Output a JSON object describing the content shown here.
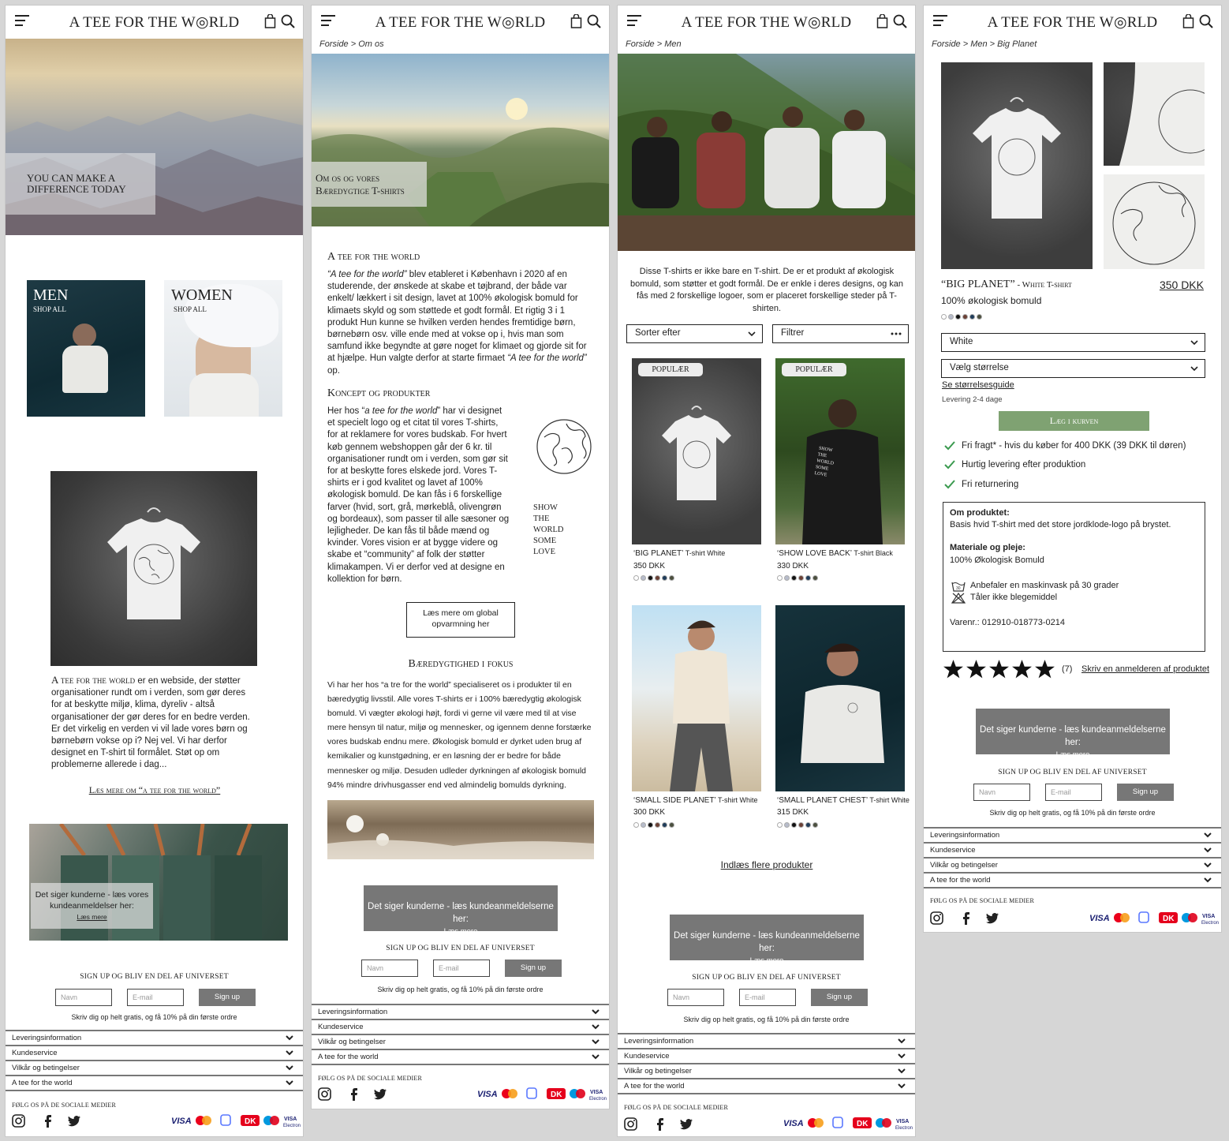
{
  "brand": "A TEE FOR THE W◎RLD",
  "home": {
    "hero_text_line1": "YOU CAN MAKE A",
    "hero_text_line2": "DIFFERENCE TODAY",
    "men_title": "MEN",
    "men_sub": "SHOP ALL",
    "women_title": "WOMEN",
    "women_sub": "SHOP ALL",
    "about_brand": "A tee for the world",
    "about_text": " er en webside, der støtter organisationer rundt om i verden, som gør deres for at beskytte miljø, klima, dyreliv - altså organisationer der gør deres for en bedre verden. Er det virkelig en verden vi vil lade vores børn og børnebørn vokse op i? Nej vel. Vi har derfor designet en T-shirt til formålet. Støt op om problemerne allerede i dag...",
    "read_more": "Læs mere om “a tee for the world”",
    "review_line1": "Det siger kunderne - læs vores",
    "review_line2": "kundeanmeldelser her:",
    "review_link": "Læs mere"
  },
  "about": {
    "breadcrumb": "Forside > Om os",
    "hero_line1": "Om os og vores",
    "hero_line2": "Bæredygtige T-shirts",
    "h1": "A tee for the world",
    "p1_em": "“A tee for the world”",
    "p1": " blev etableret i København i 2020 af en studerende, der ønskede at skabe et tøjbrand, der både var enkelt/ lækkert i sit design, lavet at 100% økologisk bomuld for klimaets skyld og som støttede et godt formål. Et rigtig 3 i 1 produkt Hun kunne se hvilken verden hendes fremtidige børn, børnebørn osv. ville ende med at vokse op i, hvis man som samfund ikke begyndte at gøre noget for klimaet og gjorde sit for at hjælpe. Hun valgte derfor at starte firmaet ",
    "p1_em2": "“A tee for the world”",
    "p1_end": " op.",
    "h2": "Koncept og produkter",
    "p2_start": "Her hos “",
    "p2_em": "a tee for the world",
    "p2": "” har vi designet et specielt logo og et citat til vores T-shirts, for at reklamere for vores budskab. For hvert køb gennem webshoppen går der 6 kr. til organisationer rundt om i verden, som gør sit for at beskytte fores elskede jord. Vores T-shirts er i god kvalitet og lavet af 100% økologisk bomuld. De kan fås i 6 forskellige farver (hvid, sort, grå, mørkeblå, olivengrøn og bordeaux), som passer til alle sæsoner og lejligheder. De kan fås til både mænd og kvinder. Vores vision er at bygge videre og skabe et “community” af folk der støtter klimakampen. Vi er derfor ved at designe en kollektion for børn.",
    "quote": [
      "SHOW",
      "THE",
      "WORLD",
      "SOME",
      "LOVE"
    ],
    "btn_line1": "Læs mere om global",
    "btn_line2": "opvarmning her",
    "h3": "Bæredygtighed i fokus",
    "p3": "Vi har her hos “a tre for the world” specialiseret os i produkter til en bæredygtig livsstil. Alle vores T-shirts er i 100% bæredygtig økologisk bomuld. Vi vægter økologi højt, fordi vi gerne vil være med til at vise mere hensyn til natur, miljø og mennesker, og igennem denne forstærke vores budskab endnu mere. Økologisk bomuld er dyrket uden brug af kemikalier og kunstgødning, er en løsning der er bedre for både mennesker og miljø. Desuden udleder dyrkningen af økologisk bomuld 94% mindre drivhusgasser end ved almindelig bomulds dyrkning.",
    "review_text": "Det siger kunderne - læs kundeanmeldelserne her:",
    "review_link": "Læs mere"
  },
  "men": {
    "breadcrumb": "Forside > Men",
    "intro": "Disse T-shirts er ikke bare en T-shirt. De er et produkt af økologisk bomuld, som støtter et godt formål. De er enkle i deres designs, og kan fås med 2 forskellige logoer, som er placeret forskellige steder på T-shirten.",
    "sort_label": "Sorter efter",
    "filter_label": "Filtrer",
    "badge": "POPULÆR",
    "products": [
      {
        "name": "‘BIG PLANET’",
        "variant": " T-shirt White",
        "price": "350 DKK"
      },
      {
        "name": "‘SHOW LOVE BACK’",
        "variant": " T-shirt Black",
        "price": "330 DKK"
      },
      {
        "name": "‘SMALL SIDE PLANET’",
        "variant": " T-shirt White",
        "price": "300 DKK"
      },
      {
        "name": "‘SMALL PLANET CHEST’",
        "variant": " T-shirt White",
        "price": "315 DKK"
      }
    ],
    "shirt_print": [
      "SHOW",
      "THE",
      "WORLD",
      "SOME",
      "LOVE"
    ],
    "load_more": "Indlæs flere produkter",
    "review_text": "Det siger kunderne - læs kundeanmeldelserne her:",
    "review_link": "Læs mere"
  },
  "product": {
    "breadcrumb": "Forside > Men > Big Planet",
    "title": "“BIG PLANET”",
    "subtitle": " - White T-shirt",
    "price": "350 DKK",
    "material": "100% økologisk bomuld",
    "color_select": "White",
    "size_select": "Vælg størrelse",
    "size_guide": "Se størrelsesguide",
    "delivery": "Levering 2-4 dage",
    "add_to_cart": "Læg i kurven",
    "benefits": [
      "Fri fragt* - hvis du køber for 400 DKK  (39 DKK til døren)",
      "Hurtig levering efter produktion",
      "Fri returnering"
    ],
    "about_title": "Om produktet:",
    "about_text": "Basis hvid T-shirt med det store jordklode-logo på brystet.",
    "care_title": "Materiale og pleje:",
    "care_text": "100% Økologisk Bomuld",
    "wash": "Anbefaler en maskinvask på 30 grader",
    "bleach": "Tåler ikke blegemiddel",
    "sku": "Varenr.: 012910-018773-0214",
    "rating_count": "(7)",
    "review_link": "Skriv en anmelderen af produktet",
    "review_text": "Det siger kunderne - læs kundeanmeldelserne her:",
    "review_more": "Læs mere"
  },
  "signup": {
    "title": "SIGN UP OG BLIV EN DEL AF UNIVERSET",
    "name_placeholder": "Navn",
    "email_placeholder": "E-mail",
    "button": "Sign up",
    "note": "Skriv dig op helt gratis, og få 10% på din første ordre"
  },
  "footer": {
    "accordion": [
      "Leveringsinformation",
      "Kundeservice",
      "Vilkår og betingelser",
      "A tee for the world"
    ],
    "social_title": "FØLG OS PÅ DE SOCIALE MEDIER",
    "payments": [
      "VISA",
      "Mastercard",
      "MobilePay",
      "Dankort",
      "Maestro",
      "VISA Electron"
    ]
  },
  "swatch_colors": [
    "#ffffff",
    "#b7bccb",
    "#111111",
    "#6b4035",
    "#1f3c5a",
    "#4b4f3e"
  ],
  "colors": {
    "accent_green": "#7fa272",
    "review_grey": "#777777"
  }
}
